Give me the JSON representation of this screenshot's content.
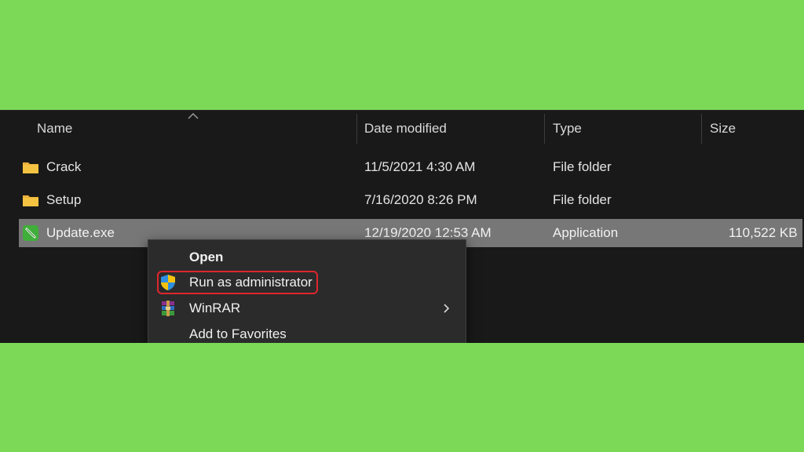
{
  "columns": {
    "name": "Name",
    "date_modified": "Date modified",
    "type": "Type",
    "size": "Size"
  },
  "files": [
    {
      "name": "Crack",
      "date": "11/5/2021 4:30 AM",
      "type": "File folder",
      "size": "",
      "icon": "folder-icon",
      "selected": false
    },
    {
      "name": "Setup",
      "date": "7/16/2020 8:26 PM",
      "type": "File folder",
      "size": "",
      "icon": "folder-icon",
      "selected": false
    },
    {
      "name": "Update.exe",
      "date": "12/19/2020 12:53 AM",
      "type": "Application",
      "size": "110,522 KB",
      "icon": "app-pen-icon",
      "selected": true
    }
  ],
  "context_menu": {
    "items": [
      {
        "label": "Open",
        "icon": "",
        "bold": true
      },
      {
        "label": "Run as administrator",
        "icon": "uac-shield-icon",
        "highlighted": true
      },
      {
        "label": "WinRAR",
        "icon": "winrar-icon",
        "submenu": true
      },
      {
        "label": "Add to Favorites",
        "icon": ""
      }
    ]
  },
  "colors": {
    "background": "#7cd957",
    "explorer_bg": "#191919",
    "selection": "#777777",
    "menu_bg": "#2b2b2b",
    "highlight_border": "#e0262d",
    "folder": "#f5c342"
  }
}
